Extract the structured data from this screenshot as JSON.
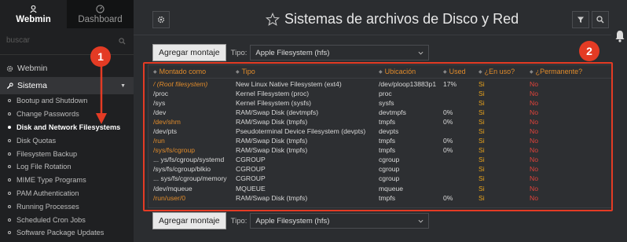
{
  "sidebar": {
    "tabs": [
      {
        "label": "Webmin",
        "icon": "webmin-logo-icon"
      },
      {
        "label": "Dashboard",
        "icon": "dashboard-gauge-icon"
      }
    ],
    "search_placeholder": "buscar",
    "categories": [
      {
        "label": "Webmin",
        "icon": "gear-icon"
      },
      {
        "label": "Sistema",
        "icon": "wrench-icon"
      }
    ],
    "items": [
      {
        "label": "Bootup and Shutdown"
      },
      {
        "label": "Change Passwords"
      },
      {
        "label": "Disk and Network Filesystems"
      },
      {
        "label": "Disk Quotas"
      },
      {
        "label": "Filesystem Backup"
      },
      {
        "label": "Log File Rotation"
      },
      {
        "label": "MIME Type Programs"
      },
      {
        "label": "PAM Authentication"
      },
      {
        "label": "Running Processes"
      },
      {
        "label": "Scheduled Cron Jobs"
      },
      {
        "label": "Software Package Updates"
      }
    ]
  },
  "header": {
    "title": "Sistemas de archivos de Disco y Red"
  },
  "toolbar": {
    "add_label": "Agregar montaje",
    "tipo_label": "Tipo:",
    "tipo_value": "Apple Filesystem (hfs)"
  },
  "table": {
    "columns": [
      "Montado como",
      "Tipo",
      "Ubicación",
      "Used",
      "¿En uso?",
      "¿Permanente?"
    ],
    "rows": [
      {
        "mount": "/ (Root filesystem)",
        "type": "New Linux Native Filesystem (ext4)",
        "loc": "/dev/ploop13883p1",
        "used": "17%",
        "inuse": "Si",
        "perm": "No"
      },
      {
        "mount": "/proc",
        "type": "Kernel Filesystem (proc)",
        "loc": "proc",
        "used": "",
        "inuse": "Si",
        "perm": "No"
      },
      {
        "mount": "/sys",
        "type": "Kernel Filesystem (sysfs)",
        "loc": "sysfs",
        "used": "",
        "inuse": "Si",
        "perm": "No"
      },
      {
        "mount": "/dev",
        "type": "RAM/Swap Disk (devtmpfs)",
        "loc": "devtmpfs",
        "used": "0%",
        "inuse": "Si",
        "perm": "No"
      },
      {
        "mount": "/dev/shm",
        "type": "RAM/Swap Disk (tmpfs)",
        "loc": "tmpfs",
        "used": "0%",
        "inuse": "Si",
        "perm": "No"
      },
      {
        "mount": "/dev/pts",
        "type": "Pseudoterminal Device Filesystem (devpts)",
        "loc": "devpts",
        "used": "",
        "inuse": "Si",
        "perm": "No"
      },
      {
        "mount": "/run",
        "type": "RAM/Swap Disk (tmpfs)",
        "loc": "tmpfs",
        "used": "0%",
        "inuse": "Si",
        "perm": "No"
      },
      {
        "mount": "/sys/fs/cgroup",
        "type": "RAM/Swap Disk (tmpfs)",
        "loc": "tmpfs",
        "used": "0%",
        "inuse": "Si",
        "perm": "No"
      },
      {
        "mount": "... ys/fs/cgroup/systemd",
        "type": "CGROUP",
        "loc": "cgroup",
        "used": "",
        "inuse": "Si",
        "perm": "No"
      },
      {
        "mount": "/sys/fs/cgroup/blkio",
        "type": "CGROUP",
        "loc": "cgroup",
        "used": "",
        "inuse": "Si",
        "perm": "No"
      },
      {
        "mount": "... sys/fs/cgroup/memory",
        "type": "CGROUP",
        "loc": "cgroup",
        "used": "",
        "inuse": "Si",
        "perm": "No"
      },
      {
        "mount": "/dev/mqueue",
        "type": "MQUEUE",
        "loc": "mqueue",
        "used": "",
        "inuse": "Si",
        "perm": "No"
      },
      {
        "mount": "/run/user/0",
        "type": "RAM/Swap Disk (tmpfs)",
        "loc": "tmpfs",
        "used": "0%",
        "inuse": "Si",
        "perm": "No"
      }
    ]
  },
  "annotations": {
    "badge1": "1",
    "badge2": "2",
    "color": "#e43b24"
  },
  "colors": {
    "accent": "#e08b2b",
    "si": "#e8a21a",
    "no": "#e0433a"
  }
}
